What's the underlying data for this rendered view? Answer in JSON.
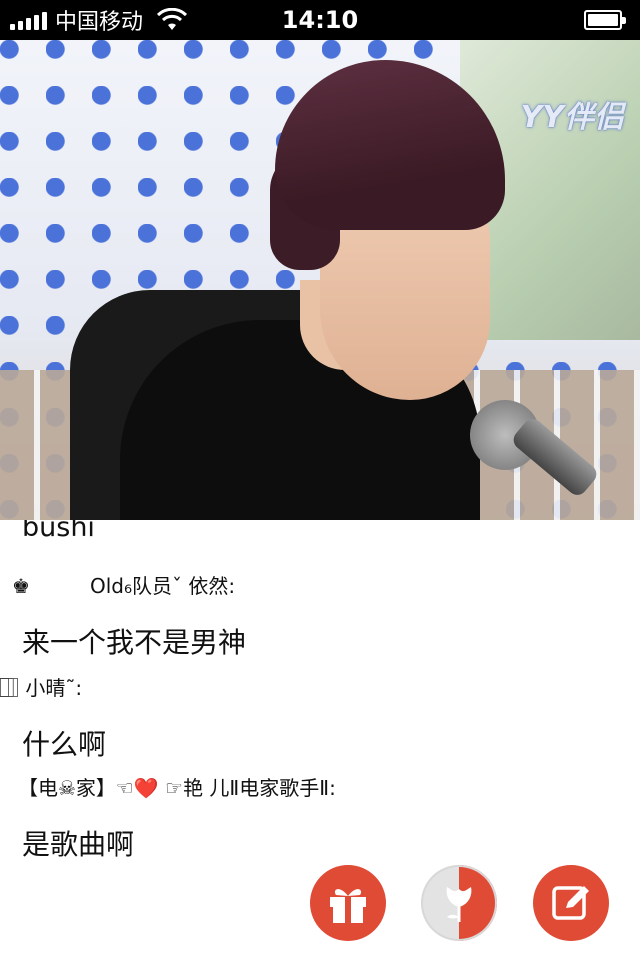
{
  "status_bar": {
    "carrier": "中国移动",
    "time": "14:10",
    "battery_level": 1.0
  },
  "video": {
    "watermark": "YY伴侣"
  },
  "chat": {
    "partial_message": "bushi",
    "messages": [
      {
        "sender": "Old₆队员ˇ 依然:",
        "text": "来一个我不是男神"
      },
      {
        "sender": "⃞ ⃞ ⃞ 小晴˜:",
        "text": "什么啊"
      },
      {
        "sender": "【电☠家】☜❤️ ☞艳 儿Ⅱ电家歌手Ⅱ:",
        "text": "是歌曲啊"
      }
    ]
  },
  "actions": {
    "gift": "gift-icon",
    "flower": "flower-icon",
    "compose": "edit-icon"
  },
  "colors": {
    "accent": "#e04b36",
    "status_bar_bg": "#000000"
  }
}
